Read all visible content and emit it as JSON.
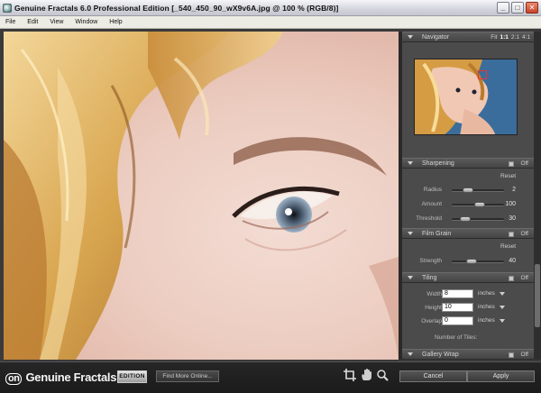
{
  "window": {
    "title": "Genuine Fractals 6.0 Professional Edition [_540_450_90_wX9v6A.jpg @ 100 % (RGB/8)]",
    "minimize": "_",
    "maximize": "□",
    "close": "✕"
  },
  "menu": [
    "File",
    "Edit",
    "View",
    "Window",
    "Help"
  ],
  "navigator": {
    "title": "Navigator",
    "zoom_options": [
      "Fit",
      "1:1",
      "2:1",
      "4:1"
    ],
    "active_zoom": "1:1"
  },
  "sharpening": {
    "title": "Sharpening",
    "state": "Off",
    "reset": "Reset",
    "radius": {
      "label": "Radius",
      "value": "2",
      "fraction": 0.25
    },
    "amount": {
      "label": "Amount",
      "value": "100",
      "fraction": 0.55
    },
    "threshold": {
      "label": "Threshold",
      "value": "30",
      "fraction": 0.2
    }
  },
  "film_grain": {
    "title": "Film Grain",
    "state": "Off",
    "reset": "Reset",
    "strength": {
      "label": "Strength",
      "value": "40",
      "fraction": 0.35
    }
  },
  "tiling": {
    "title": "Tiling",
    "state": "Off",
    "width": {
      "label": "Width",
      "value": "8",
      "unit": "inches"
    },
    "height": {
      "label": "Height",
      "value": "10",
      "unit": "inches"
    },
    "overlap": {
      "label": "Overlap",
      "value": "0",
      "unit": "inches"
    },
    "tiles_label": "Number of Tiles:"
  },
  "gallery_wrap": {
    "title": "Gallery Wrap",
    "state": "Off"
  },
  "bottom": {
    "logo_on": "on",
    "logo_name": "Genuine Fractals",
    "logo_version": "6",
    "edition": "EDITION",
    "find_more": "Find More Online...",
    "cancel": "Cancel",
    "apply": "Apply"
  },
  "colors": {
    "panel_bg": "#4b4b4b",
    "header_bg": "#454545",
    "bottom_bg": "#1b1b1b",
    "nav_frame": "#ee3333"
  }
}
